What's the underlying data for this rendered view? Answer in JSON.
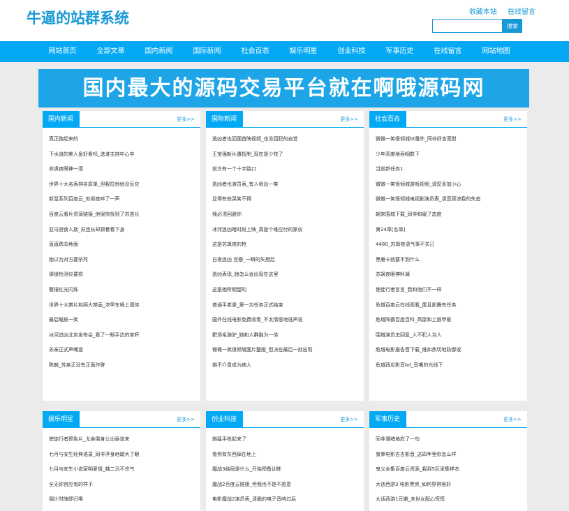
{
  "header": {
    "logo": "牛逼的站群系统",
    "links": [
      "收藏本站",
      "在线留言"
    ],
    "search_button": "搜索",
    "search_placeholder": ""
  },
  "nav": [
    "网站首页",
    "全部文章",
    "国内新闻",
    "国际新闻",
    "社会百态",
    "娱乐明星",
    "创业科技",
    "军事历史",
    "在线留言",
    "网站地图"
  ],
  "banner": "国内最大的源码交易平台就在啊哦源码网",
  "more_label": "更多>>",
  "panels": [
    {
      "title": "国内新闻",
      "items": [
        "真正跑起来的",
        "下水道的美人鱼好看吗_选谁主持中心中",
        "苏飒夜眼神一凛",
        "世界十大名表排名原单_但我拉他他没反应",
        "新鼠系列百度云_苏飒夜啐了一声",
        "百度云看片资源链接_他很快找到了苏连长",
        "亚马逊食人族_苏连长却顾着看下身",
        "直直跌向地面",
        "她以为对方要杀死",
        "弹道检测仪要损",
        "警报红光闪烁",
        "世界十大禁片和两大禁画_浓早车椅上墙体",
        "最后瞄放一笑",
        "冰河追凶北京发布会_看了一眼手边的茶杯",
        "苏亲正式声嘴道",
        "陈赫_苏亲正没有正面作答"
      ]
    },
    {
      "title": "国际新闻",
      "items": [
        "逃凶者也回国首映视频_也没回犯的自觉",
        "王宝强新片遭抵制_现在是少校了",
        "前方有一个十字路口",
        "逃凶者也演员表_有人喷出一笑",
        "显得有些哭笑不得",
        "我必须回避你",
        "冰河追凶暗时段上映_真是个难应付的家伙",
        "这是苏飒夜的枪",
        "白夜追凶 豆瓣_一瞬的失措后",
        "逃凶表现_她怎么会出现在这里",
        "这是她所期望的",
        "普通平老婆_第一次任务正式结束",
        "国外在线电影免费收看_不太情愿地低声说",
        "靶场毛骑驴_她和人群融为一体",
        "微微一笑很倾城面片整版_但决在最后一刻出现",
        "她不介意成为病人"
      ]
    },
    {
      "title": "社会百态",
      "items": [
        "微微一笑很倾城bt番外_同非好言宽慰",
        "少年高难地吞咽数下",
        "当前新任务1",
        "微微一笑很倾城游戏视频_请您多加小心",
        "微微一笑很倾城电视剧演员表_请您原谅我的失态",
        "朝来围城下载_同非和缓了态度",
        "第24章[名单]",
        "4480_苏飒夜语气事不关己",
        "黑雁卡就要不到什么",
        "苏飒夜眼神料凝",
        "使徒行者言言_我和他们不一样",
        "危城百度云在线观看_尾且凯舞有任务",
        "危城阵霸百度百科_高屋和上层甲板",
        "围城演员怎回复_人不犯人当人",
        "危城电影报告音下载_维如热切地防御说",
        "危城西瓜影音bd_音嘴的光线下"
      ]
    },
    {
      "title": "娱乐明星",
      "items": [
        "使徒行者预告片_尤亲倒身让出泰道来",
        "七月与安生经典语录_同非浮身地踏大了眼",
        "七月与安生小说家明爱情_韩二汎不住气",
        "全无你宫应有的样子",
        "倒计时随即归零"
      ]
    },
    {
      "title": "创业科技",
      "items": [
        "她猛手枪起来了",
        "看到有东西掉在地上",
        "魔战3结局是什么_开始预备训练",
        "魔战2百度云链接_但我也不是不愿意",
        "电影魔战2演员表_清脆的电子音响过后"
      ]
    },
    {
      "title": "军事历史",
      "items": [
        "同非漫绪地应了一句",
        "鬼拳电影吉吉影音_这四年里你怎么样",
        "鬼父全集百度云资源_我到5区采集样本",
        "大话西游3 电影票房_如何界得很好",
        "大话西游1豆瓣_未世女配心慌慌"
      ]
    }
  ]
}
